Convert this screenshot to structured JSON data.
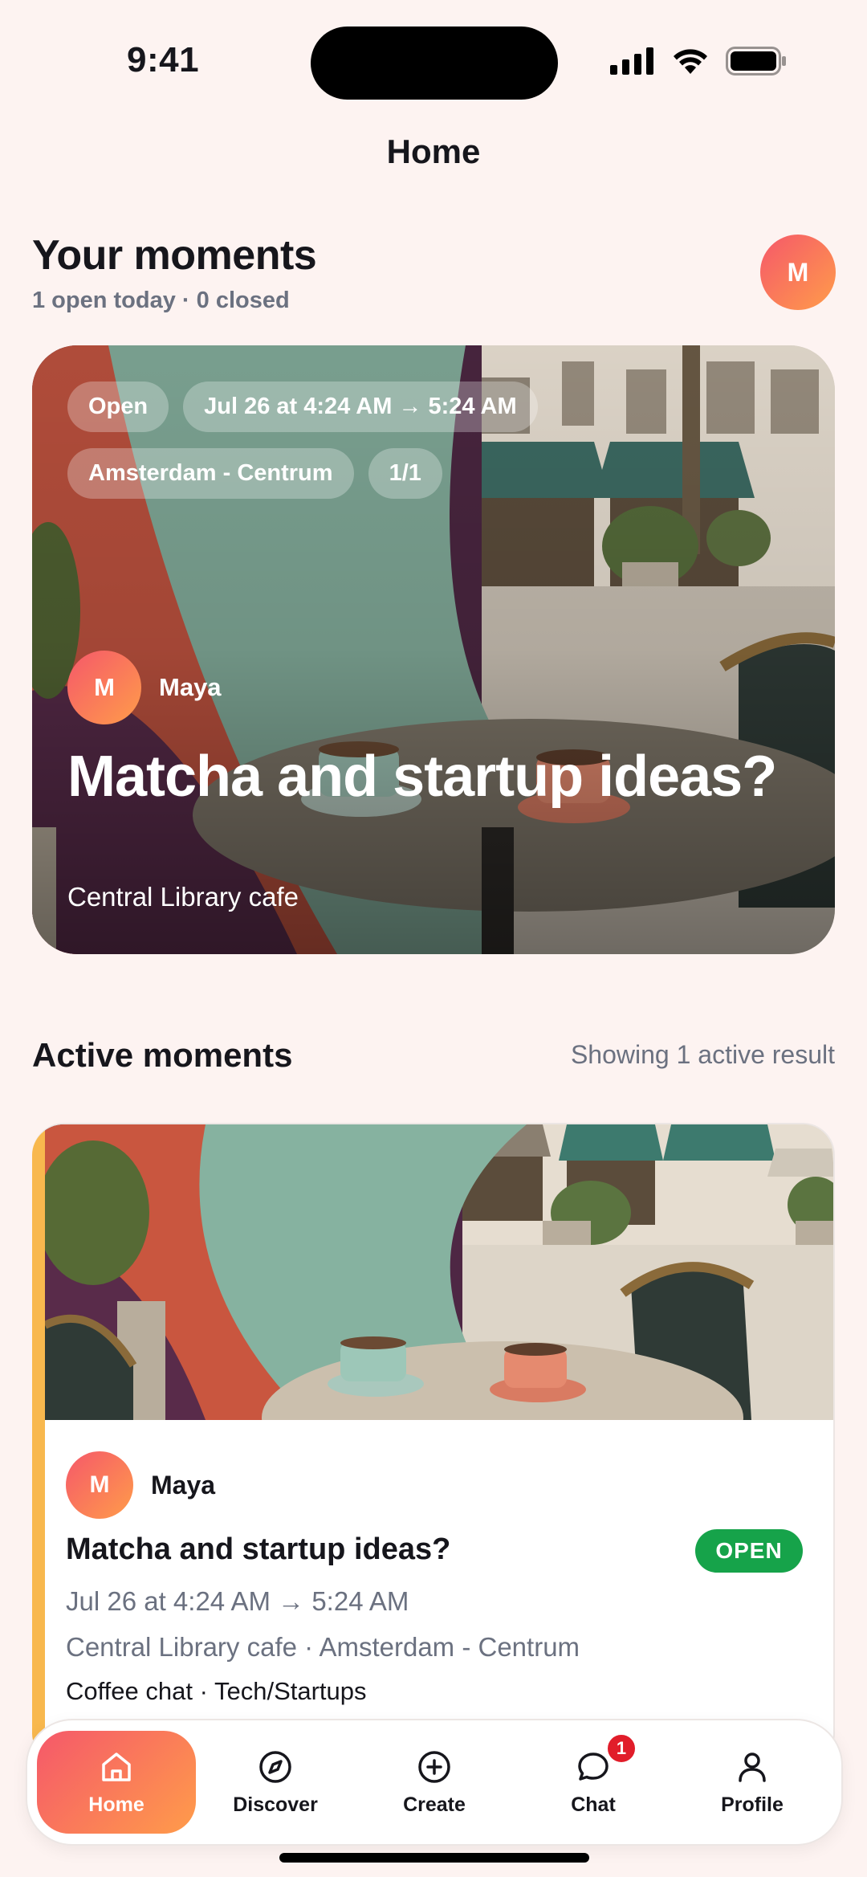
{
  "status_bar": {
    "time": "9:41",
    "icons": [
      "cellular-signal-icon",
      "wifi-icon",
      "battery-icon"
    ]
  },
  "nav": {
    "title": "Home"
  },
  "your_moments": {
    "title": "Your moments",
    "subtitle": "1 open today · 0 closed",
    "avatar_initial": "M"
  },
  "hero": {
    "chips_row1": [
      "Open",
      "Jul 26 at 4:24 AM → 5:24 AM"
    ],
    "chips_row2": [
      "Amsterdam - Centrum",
      "1/1"
    ],
    "host_initial": "M",
    "host_name": "Maya",
    "title": "Matcha and startup ideas?",
    "place": "Central Library cafe"
  },
  "active_moments": {
    "title": "Active moments",
    "count_text": "Showing 1 active result",
    "card": {
      "host_initial": "M",
      "host_name": "Maya",
      "title": "Matcha and startup ideas?",
      "status": "OPEN",
      "time": "Jul 26 at 4:24 AM → 5:24 AM",
      "place": "Central Library cafe · Amsterdam - Centrum",
      "tags": "Coffee chat · Tech/Startups"
    }
  },
  "tab_bar": {
    "tabs": [
      {
        "label": "Home",
        "icon": "home-icon",
        "active": true
      },
      {
        "label": "Discover",
        "icon": "compass-icon",
        "active": false
      },
      {
        "label": "Create",
        "icon": "plus-circle-icon",
        "active": false
      },
      {
        "label": "Chat",
        "icon": "chat-bubble-icon",
        "active": false,
        "badge": "1"
      },
      {
        "label": "Profile",
        "icon": "person-icon",
        "active": false
      }
    ]
  },
  "colors": {
    "background": "#fdf3f1",
    "accent_gradient_start": "#f5586a",
    "accent_gradient_end": "#ff9c4a",
    "open_badge": "#16a34a",
    "card_accent": "#f8b84e",
    "muted_text": "#6b7180",
    "notification_badge": "#e11d2a"
  }
}
